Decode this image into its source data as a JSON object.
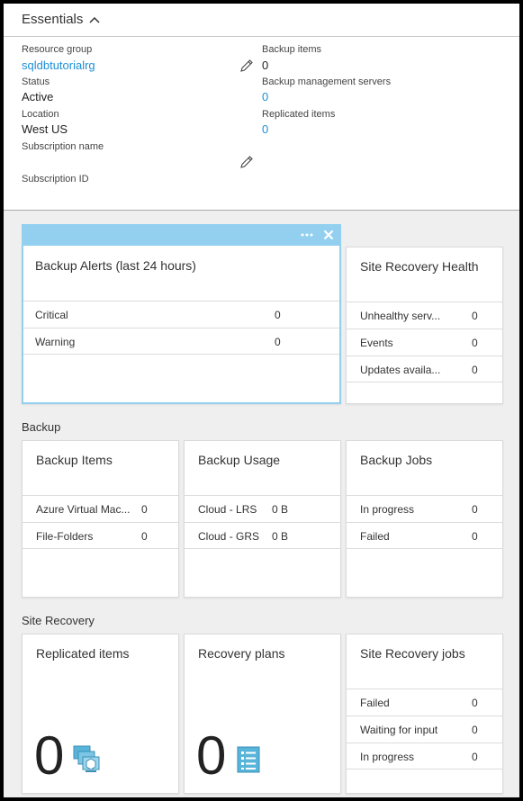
{
  "essentials": {
    "title": "Essentials",
    "left": [
      {
        "label": "Resource group",
        "value": "sqldbtutorialrg",
        "link": true
      },
      {
        "label": "Status",
        "value": "Active",
        "link": false
      },
      {
        "label": "Location",
        "value": "West US",
        "link": false
      },
      {
        "label": "Subscription name",
        "value": "",
        "link": false
      },
      {
        "label": "Subscription ID",
        "value": "",
        "link": false
      }
    ],
    "right": [
      {
        "label": "Backup items",
        "value": "0",
        "link": false
      },
      {
        "label": "Backup management servers",
        "value": "0",
        "link": true
      },
      {
        "label": "Replicated items",
        "value": "0",
        "link": true
      }
    ]
  },
  "alerts_tile": {
    "title": "Backup Alerts (last 24 hours)",
    "rows": [
      {
        "label": "Critical",
        "value": "0"
      },
      {
        "label": "Warning",
        "value": "0"
      }
    ]
  },
  "sr_health_tile": {
    "title": "Site Recovery Health",
    "rows": [
      {
        "label": "Unhealthy serv...",
        "value": "0"
      },
      {
        "label": "Events",
        "value": "0"
      },
      {
        "label": "Updates availa...",
        "value": "0"
      }
    ]
  },
  "backup_section": {
    "title": "Backup",
    "items_tile": {
      "title": "Backup Items",
      "rows": [
        {
          "label": "Azure Virtual Mac...",
          "value": "0"
        },
        {
          "label": "File-Folders",
          "value": "0"
        }
      ]
    },
    "usage_tile": {
      "title": "Backup Usage",
      "rows": [
        {
          "label": "Cloud - LRS",
          "value": "0 B"
        },
        {
          "label": "Cloud - GRS",
          "value": "0 B"
        }
      ]
    },
    "jobs_tile": {
      "title": "Backup Jobs",
      "rows": [
        {
          "label": "In progress",
          "value": "0"
        },
        {
          "label": "Failed",
          "value": "0"
        }
      ]
    }
  },
  "site_recovery_section": {
    "title": "Site Recovery",
    "replicated_tile": {
      "title": "Replicated items",
      "count": "0"
    },
    "plans_tile": {
      "title": "Recovery plans",
      "count": "0"
    },
    "jobs_tile": {
      "title": "Site Recovery jobs",
      "rows": [
        {
          "label": "Failed",
          "value": "0"
        },
        {
          "label": "Waiting for input",
          "value": "0"
        },
        {
          "label": "In progress",
          "value": "0"
        }
      ]
    }
  },
  "colors": {
    "link": "#1e8fd6",
    "selection_bar": "#93d0f0",
    "tile_border": "#dadada",
    "blade_background": "#efefef"
  },
  "icons": {
    "collapse": "chevron-up-icon",
    "edit": "pencil-icon",
    "more": "ellipsis-icon",
    "close": "close-icon",
    "replicated": "vm-stack-icon",
    "plans": "list-document-icon"
  }
}
